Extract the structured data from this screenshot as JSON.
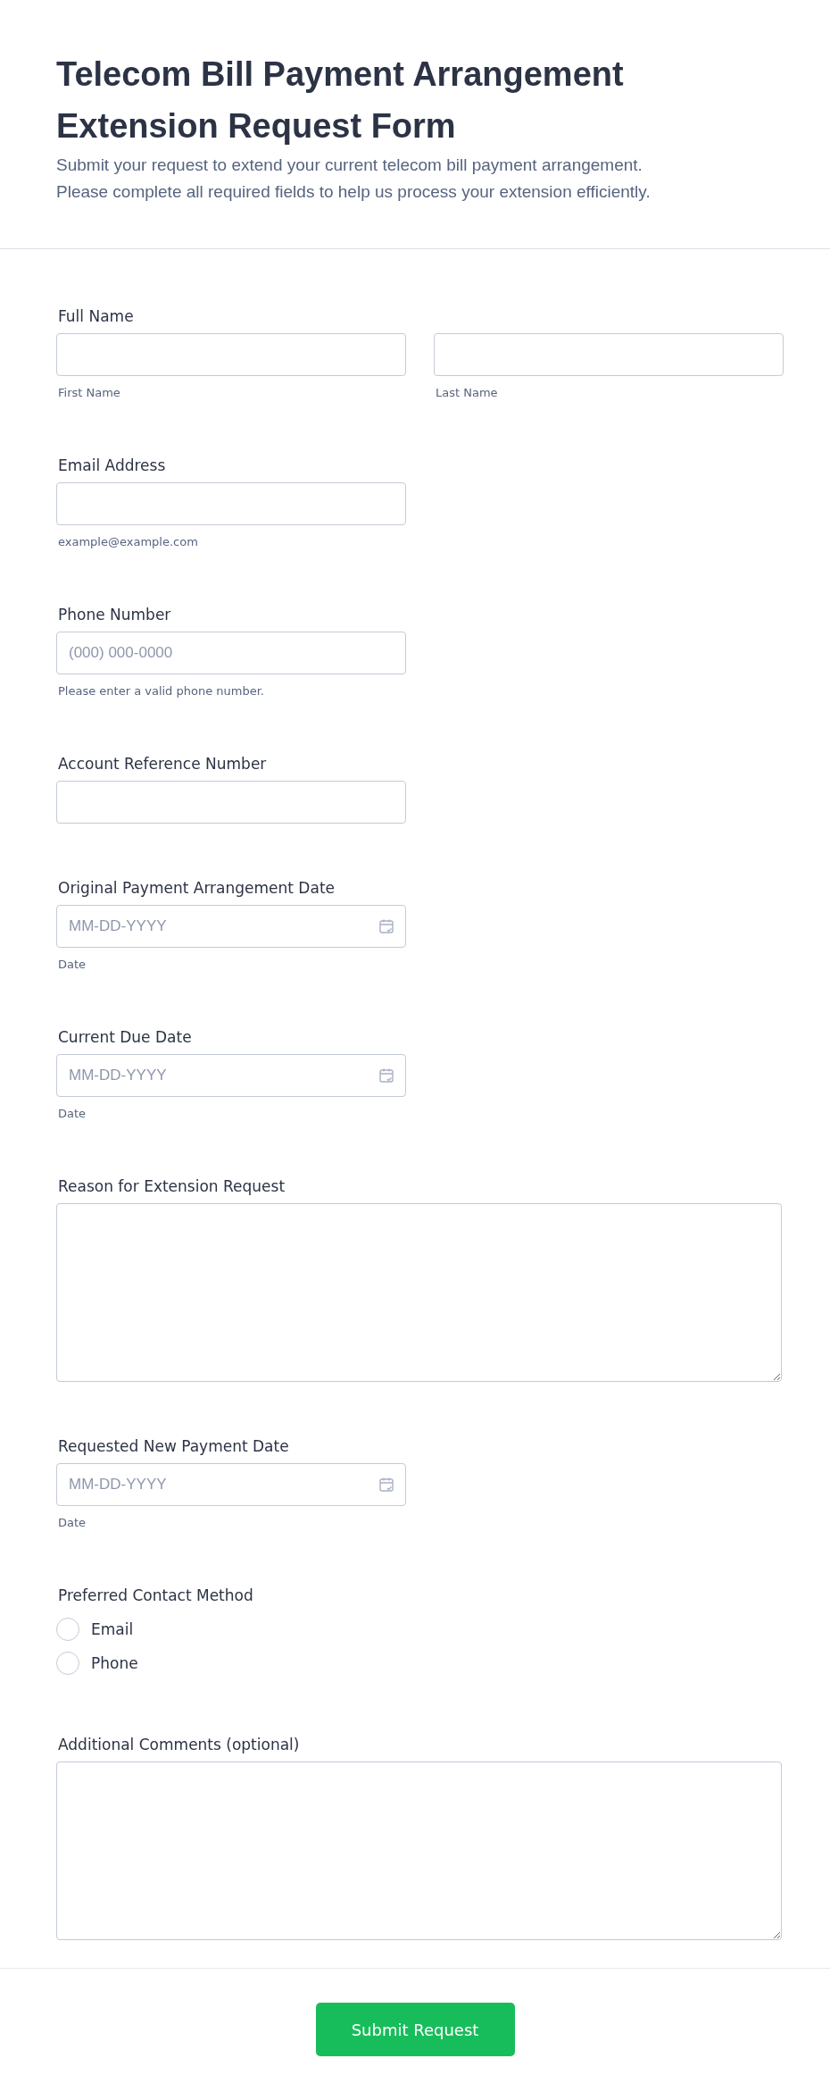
{
  "header": {
    "title": "Telecom Bill Payment Arrangement Extension Request Form",
    "description": [
      "Submit your request to extend your current telecom bill payment arrangement.",
      "Please complete all required fields to help us process your extension efficiently."
    ]
  },
  "fields": [
    {
      "kind": "name",
      "label": "Full Name",
      "parts": [
        {
          "sublabel": "First Name"
        },
        {
          "sublabel": "Last Name"
        }
      ]
    },
    {
      "kind": "text",
      "label": "Email Address",
      "sublabel": "example@example.com"
    },
    {
      "kind": "text",
      "label": "Phone Number",
      "placeholder": "(000) 000-0000",
      "sublabel": "Please enter a valid phone number."
    },
    {
      "kind": "text",
      "label": "Account Reference Number"
    },
    {
      "kind": "date",
      "label": "Original Payment Arrangement Date",
      "placeholder": "MM-DD-YYYY",
      "sublabel": "Date"
    },
    {
      "kind": "date",
      "label": "Current Due Date",
      "placeholder": "MM-DD-YYYY",
      "sublabel": "Date"
    },
    {
      "kind": "textarea",
      "label": "Reason for Extension Request"
    },
    {
      "kind": "date",
      "label": "Requested New Payment Date",
      "placeholder": "MM-DD-YYYY",
      "sublabel": "Date"
    },
    {
      "kind": "radio",
      "label": "Preferred Contact Method",
      "options": [
        {
          "label": "Email",
          "selected": false
        },
        {
          "label": "Phone",
          "selected": false
        }
      ]
    },
    {
      "kind": "textarea",
      "label": "Additional Comments (optional)"
    }
  ],
  "submit_button": "Submit Request"
}
